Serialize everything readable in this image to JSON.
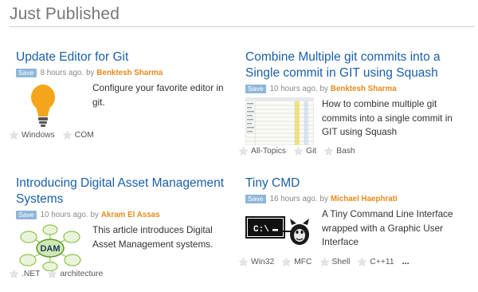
{
  "section": {
    "title": "Just Published"
  },
  "articles": [
    {
      "title": "Update Editor for Git",
      "save_label": "Save",
      "time": "8 hours ago.",
      "by": "by",
      "author": "Benktesh Sharma",
      "description": "Configure your favorite editor in git.",
      "thumbnail_icon": "lightbulb-icon",
      "tags": [
        "Windows",
        "COM"
      ]
    },
    {
      "title": "Combine Multiple git commits into a Single commit in GIT using Squash",
      "save_label": "Save",
      "time": "10 hours ago.",
      "by": "by",
      "author": "Benktesh Sharma",
      "description": "How to combine multiple git commits into a single commit in GIT using Squash",
      "thumbnail_icon": "spreadsheet-screenshot-icon",
      "tags": [
        "All-Topics",
        "Git",
        "Bash"
      ]
    },
    {
      "title": "Introducing Digital Asset Management Systems",
      "save_label": "Save",
      "time": "10 hours ago.",
      "by": "by",
      "author": "Akram El Assas",
      "description": "This article introduces Digital Asset Management systems.",
      "thumbnail_icon": "dam-diagram-icon",
      "thumbnail_text": "DAM",
      "tags": [
        ".NET",
        "architecture"
      ]
    },
    {
      "title": "Tiny CMD",
      "save_label": "Save",
      "time": "16 hours ago.",
      "by": "by",
      "author": "Michael Haephrati",
      "description": "A Tiny Command Line Interface wrapped with a Graphic User Interface",
      "thumbnail_icon": "terminal-icon",
      "thumbnail_text": "C:\\",
      "tags": [
        "Win32",
        "MFC",
        "Shell",
        "C++11"
      ],
      "more_label": "..."
    }
  ],
  "colors": {
    "link": "#1a5fa8",
    "author": "#e8891b",
    "save_badge": "#8fb6d9",
    "heading": "#777777"
  }
}
